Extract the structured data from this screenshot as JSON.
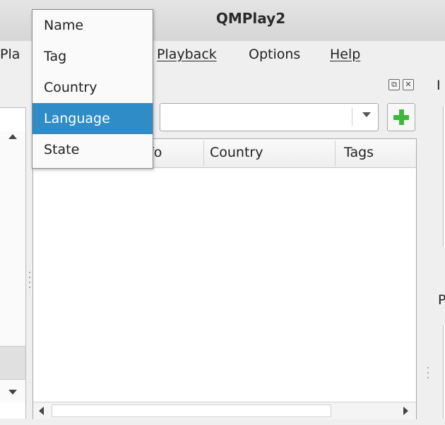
{
  "window": {
    "title": "QMPlay2"
  },
  "menubar": {
    "items": [
      {
        "label": "Pla",
        "mnemonic_index": null
      },
      {
        "label": "Playback",
        "mnemonic_index": 0
      },
      {
        "label": "Options",
        "mnemonic_index": 2
      },
      {
        "label": "Help",
        "mnemonic_index": 0
      }
    ]
  },
  "dropdown_menu": {
    "items": [
      "Name",
      "Tag",
      "Country",
      "Language",
      "State"
    ],
    "selected": "Language"
  },
  "search": {
    "value": "",
    "add_button_icon": "plus-icon"
  },
  "table": {
    "columns": [
      "fo",
      "Country",
      "Tags"
    ],
    "rows": []
  },
  "right_panel": {
    "labels": [
      "I",
      "P"
    ]
  },
  "colors": {
    "selection": "#308cc6",
    "add_icon": "#3cb83c"
  }
}
